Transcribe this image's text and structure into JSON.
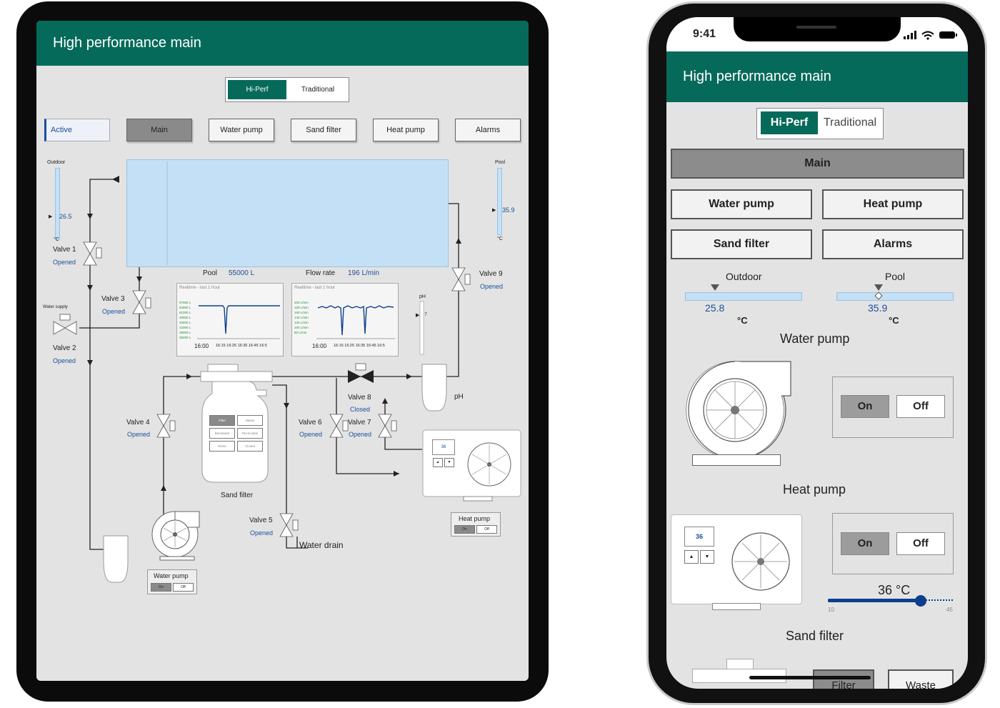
{
  "tablet": {
    "title": "High performance main",
    "mode": {
      "hiperf": "Hi-Perf",
      "traditional": "Traditional"
    },
    "nav": {
      "active": "Active",
      "main": "Main",
      "water_pump": "Water pump",
      "sand_filter": "Sand filter",
      "heat_pump": "Heat pump",
      "alarms": "Alarms"
    },
    "outdoor": {
      "label": "Outdoor",
      "value": "26.5",
      "unit": "°C"
    },
    "pool_temp": {
      "label": "Pool",
      "value": "35.9",
      "unit": "°C"
    },
    "valves": {
      "v1": {
        "name": "Valve 1",
        "state": "Opened"
      },
      "v2": {
        "name": "Valve 2",
        "state": "Opened"
      },
      "v3": {
        "name": "Valve 3",
        "state": "Opened"
      },
      "v4": {
        "name": "Valve 4",
        "state": "Opened"
      },
      "v5": {
        "name": "Valve 5",
        "state": "Opened"
      },
      "v6": {
        "name": "Valve 6",
        "state": "Opened"
      },
      "v7": {
        "name": "Valve 7",
        "state": "Opened"
      },
      "v8": {
        "name": "Valve 8",
        "state": "Closed"
      },
      "v9": {
        "name": "Valve 9",
        "state": "Opened"
      }
    },
    "water_supply": "Water supply",
    "pool_volume": {
      "label": "Pool",
      "value": "55000 L"
    },
    "flow_rate": {
      "label": "Flow rate",
      "value": "196 L/min"
    },
    "chart_volume": {
      "title": "Realtime - last 1 hour",
      "yticks": [
        "57000 L",
        "54000 L",
        "51000 L",
        "48000 L",
        "45000 L",
        "42000 L",
        "39000 L",
        "36000 L"
      ],
      "xstart": "16:00",
      "xticks": "16:15 16:25 16:35 16:45 16:5"
    },
    "chart_flow": {
      "title": "Realtime - last 1 hour",
      "yticks": [
        "200 L/min",
        "180 L/min",
        "160 L/min",
        "140 L/min",
        "120 L/min",
        "100 L/min",
        "80 L/min"
      ],
      "xstart": "16:00",
      "xticks": "16:15 16:25 16:35 16:45 16:5"
    },
    "ph": {
      "label": "pH",
      "value": "7",
      "tank_label": "pH"
    },
    "sand_filter": {
      "label": "Sand filter",
      "modes": [
        "Filter",
        "Waste",
        "Backwash",
        "Recirculate",
        "Rinse",
        "Closed"
      ]
    },
    "heat_pump": {
      "label": "Heat pump",
      "display": "36",
      "on": "On",
      "off": "Off"
    },
    "water_pump": {
      "label": "Water pump",
      "on": "On",
      "off": "Off"
    },
    "water_drain": "Water drain"
  },
  "phone": {
    "time": "9:41",
    "title": "High performance main",
    "mode": {
      "hiperf": "Hi-Perf",
      "traditional": "Traditional"
    },
    "nav": {
      "main": "Main",
      "water_pump": "Water pump",
      "heat_pump": "Heat pump",
      "sand_filter": "Sand filter",
      "alarms": "Alarms"
    },
    "outdoor": {
      "label": "Outdoor",
      "value": "25.8",
      "unit": "°C"
    },
    "pool": {
      "label": "Pool",
      "value": "35.9",
      "unit": "°C"
    },
    "water_pump": {
      "title": "Water pump",
      "on": "On",
      "off": "Off"
    },
    "heat_pump": {
      "title": "Heat pump",
      "display": "36",
      "on": "On",
      "off": "Off",
      "setpoint": "36 °C",
      "min": "10",
      "max": "45",
      "slider_fraction": 0.74
    },
    "sand_filter": {
      "title": "Sand filter",
      "filter": "Filter",
      "waste": "Waste"
    }
  },
  "colors": {
    "header": "#066a5a",
    "accent_blue": "#1a4f9c",
    "pool_fill": "#c4e0f6",
    "slider": "#0b3f8e"
  }
}
